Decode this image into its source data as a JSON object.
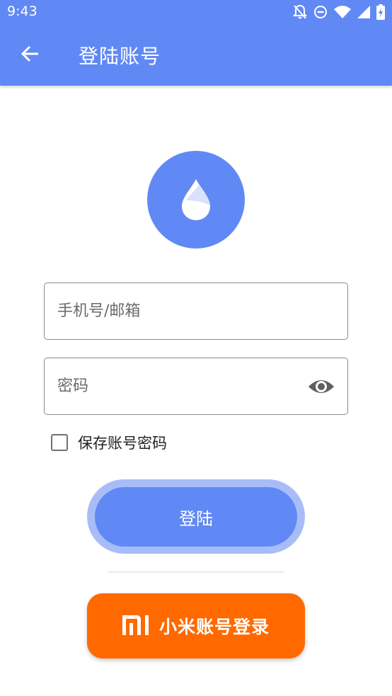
{
  "status_bar": {
    "time": "9:43",
    "icons": [
      "bell-off-icon",
      "do-not-disturb-icon",
      "wifi-icon",
      "signal-icon",
      "battery-charging-icon"
    ]
  },
  "toolbar": {
    "back_icon": "arrow-left-icon",
    "title": "登陆账号"
  },
  "logo": {
    "icon": "water-drop-icon"
  },
  "form": {
    "account_placeholder": "手机号/邮箱",
    "account_value": "",
    "password_placeholder": "密码",
    "password_value": "",
    "password_toggle_icon": "eye-icon",
    "remember_label": "保存账号密码",
    "remember_checked": false
  },
  "actions": {
    "login_label": "登陆",
    "mi_login_label": "小米账号登录"
  },
  "colors": {
    "primary": "#6189f5",
    "primary_ring": "#a8bcf8",
    "mi_orange": "#ff6900"
  }
}
